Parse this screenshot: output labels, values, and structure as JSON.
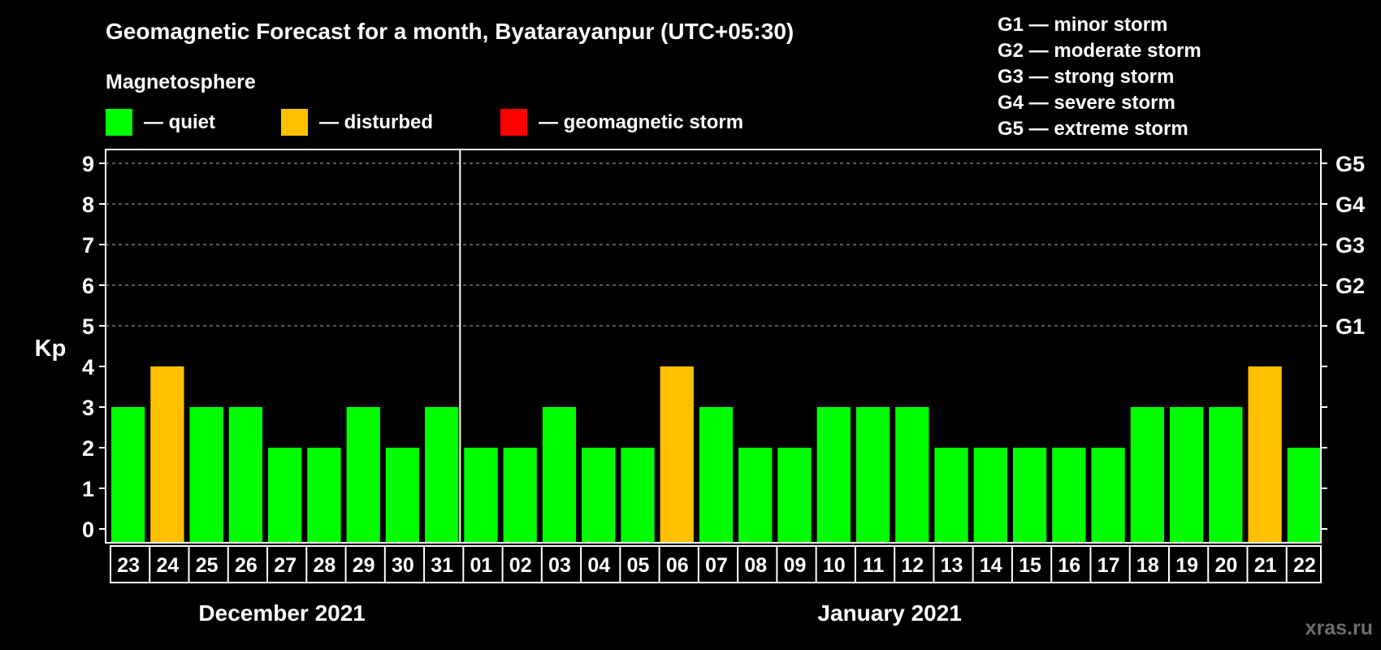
{
  "chart_data": {
    "type": "bar",
    "title": "Geomagnetic Forecast for a month, Byatarayanpur (UTC+05:30)",
    "ylabel": "Kp",
    "ylim": [
      0,
      9
    ],
    "yticks": [
      "0",
      "1",
      "2",
      "3",
      "4",
      "5",
      "6",
      "7",
      "8",
      "9"
    ],
    "grid": true,
    "legend_title": "Magnetosphere",
    "legend": [
      {
        "label": "— quiet",
        "color": "#00ff00"
      },
      {
        "label": "— disturbed",
        "color": "#ffc000"
      },
      {
        "label": "— geomagnetic storm",
        "color": "#ff0000"
      }
    ],
    "storm_levels": [
      {
        "label": "G1 — minor storm",
        "kp": 5,
        "tick": "G1"
      },
      {
        "label": "G2 — moderate storm",
        "kp": 6,
        "tick": "G2"
      },
      {
        "label": "G3 — strong storm",
        "kp": 7,
        "tick": "G3"
      },
      {
        "label": "G4 — severe storm",
        "kp": 8,
        "tick": "G4"
      },
      {
        "label": "G5 — extreme storm",
        "kp": 9,
        "tick": "G5"
      }
    ],
    "months": [
      {
        "label": "December 2021",
        "start": 0,
        "count": 9
      },
      {
        "label": "January 2021",
        "start": 9,
        "count": 22
      }
    ],
    "categories": [
      "23",
      "24",
      "25",
      "26",
      "27",
      "28",
      "29",
      "30",
      "31",
      "01",
      "02",
      "03",
      "04",
      "05",
      "06",
      "07",
      "08",
      "09",
      "10",
      "11",
      "12",
      "13",
      "14",
      "15",
      "16",
      "17",
      "18",
      "19",
      "20",
      "21",
      "22"
    ],
    "values": [
      3,
      4,
      3,
      3,
      2,
      2,
      3,
      2,
      3,
      2,
      2,
      3,
      2,
      2,
      4,
      3,
      2,
      2,
      3,
      3,
      3,
      2,
      2,
      2,
      2,
      2,
      3,
      3,
      3,
      4,
      2
    ],
    "status": [
      "quiet",
      "disturbed",
      "quiet",
      "quiet",
      "quiet",
      "quiet",
      "quiet",
      "quiet",
      "quiet",
      "quiet",
      "quiet",
      "quiet",
      "quiet",
      "quiet",
      "disturbed",
      "quiet",
      "quiet",
      "quiet",
      "quiet",
      "quiet",
      "quiet",
      "quiet",
      "quiet",
      "quiet",
      "quiet",
      "quiet",
      "quiet",
      "quiet",
      "quiet",
      "disturbed",
      "quiet"
    ],
    "colors": {
      "quiet": "#00ff00",
      "disturbed": "#ffc000",
      "storm": "#ff0000"
    },
    "watermark": "xras.ru"
  }
}
